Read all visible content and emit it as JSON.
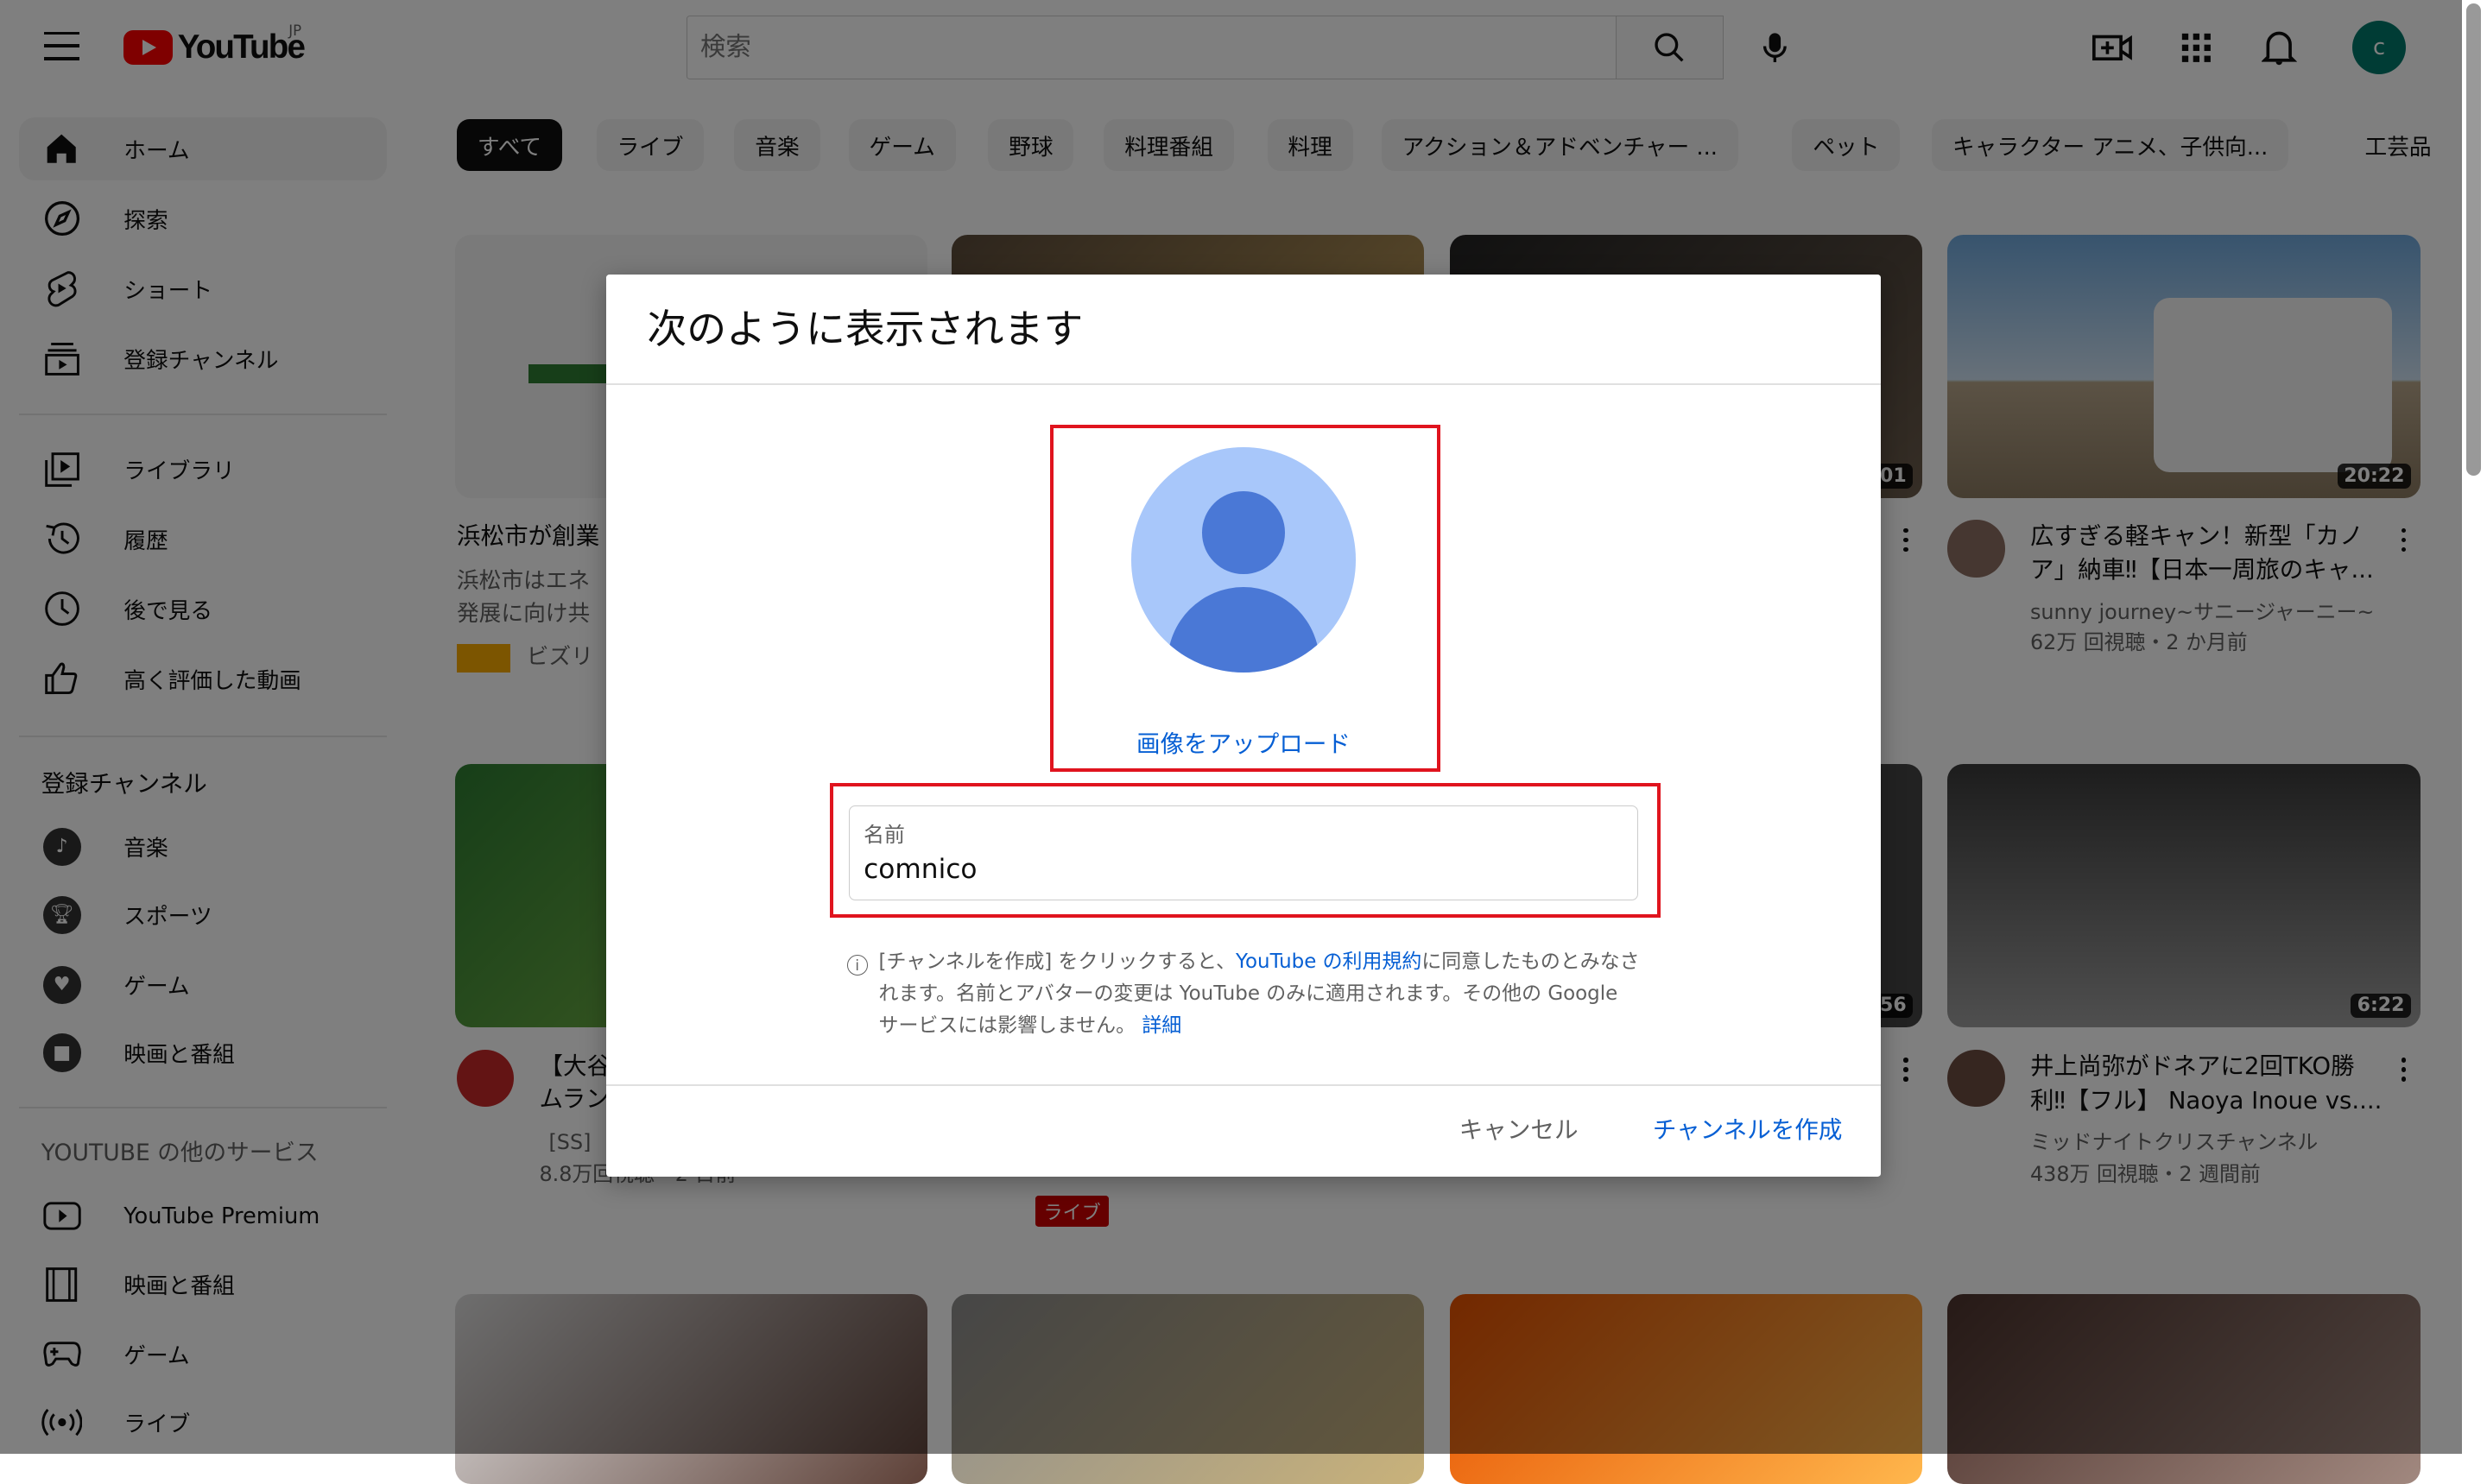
{
  "masthead": {
    "logo_text": "YouTube",
    "logo_region": "JP",
    "search_placeholder": "検索",
    "avatar_letter": "c",
    "icons": [
      "menu-icon",
      "search-icon",
      "mic-icon",
      "create-video-icon",
      "apps-icon",
      "bell-icon"
    ]
  },
  "sidebar": {
    "main_items": [
      {
        "label": "ホーム",
        "icon": "home-icon"
      },
      {
        "label": "探索",
        "icon": "explore-icon"
      },
      {
        "label": "ショート",
        "icon": "shorts-icon"
      },
      {
        "label": "登録チャンネル",
        "icon": "subscriptions-icon"
      }
    ],
    "library_items": [
      {
        "label": "ライブラリ",
        "icon": "library-icon"
      },
      {
        "label": "履歴",
        "icon": "history-icon"
      },
      {
        "label": "後で見る",
        "icon": "watch-later-icon"
      },
      {
        "label": "高く評価した動画",
        "icon": "like-icon"
      }
    ],
    "subs_heading": "登録チャンネル",
    "subs_items": [
      {
        "label": "音楽",
        "icon": "music-icon"
      },
      {
        "label": "スポーツ",
        "icon": "trophy-icon"
      },
      {
        "label": "ゲーム",
        "icon": "gaming-icon"
      },
      {
        "label": "映画と番組",
        "icon": "movies-icon"
      }
    ],
    "more_heading": "YOUTUBE の他のサービス",
    "more_items": [
      {
        "label": "YouTube Premium",
        "icon": "youtube-premium-icon"
      },
      {
        "label": "映画と番組",
        "icon": "film-icon"
      },
      {
        "label": "ゲーム",
        "icon": "gamepad-icon"
      },
      {
        "label": "ライブ",
        "icon": "live-icon"
      }
    ]
  },
  "chips": [
    "すべて",
    "ライブ",
    "音楽",
    "ゲーム",
    "野球",
    "料理番組",
    "料理",
    "アクション＆アドベンチャー ...",
    "ペット",
    "キャラクター アニメ、子供向...",
    "工芸品"
  ],
  "videos": {
    "v1": {
      "title_line1": "浜松市が創業",
      "desc_line1": "浜松市はエネ",
      "desc_line2": "発展に向け共",
      "badge": "ビズリ"
    },
    "v4": {
      "duration": "20:22",
      "title_line1": "広すぎる軽キャン！新型「カノ",
      "title_line2": "ア」納車‼【日本一周旅のキャ...",
      "channel": "sunny journey~サニージャーニー~",
      "meta": "62万 回視聴・2 か月前"
    },
    "v5": {
      "title_line1": "【大谷",
      "title_line2": "ムラン",
      "channel": "[SS]",
      "meta": "8.8万回視聴・2 日前"
    },
    "v6": {
      "live_badge": "ライブ"
    },
    "v8": {
      "duration": "6:22",
      "title_line1": "井上尚弥がドネアに2回TKO勝",
      "title_line2": "利‼【フル】 Naoya Inoue vs....",
      "channel": "ミッドナイトクリスチャンネル",
      "meta": "438万 回視聴・2 週間前"
    },
    "v3_duration": "01",
    "v7_duration": "56"
  },
  "dialog": {
    "title": "次のように表示されます",
    "upload_link": "画像をアップロード",
    "name_label": "名前",
    "name_value": "comnico",
    "notice_part1": "[チャンネルを作成] をクリックすると、",
    "notice_link": "YouTube の利用規約",
    "notice_part2": "に同意したものとみなされます。名前とアバターの変更は YouTube のみに適用されます。その他の Google サービスには影響しません。",
    "notice_details": "詳細",
    "cancel_label": "キャンセル",
    "create_label": "チャンネルを作成"
  }
}
